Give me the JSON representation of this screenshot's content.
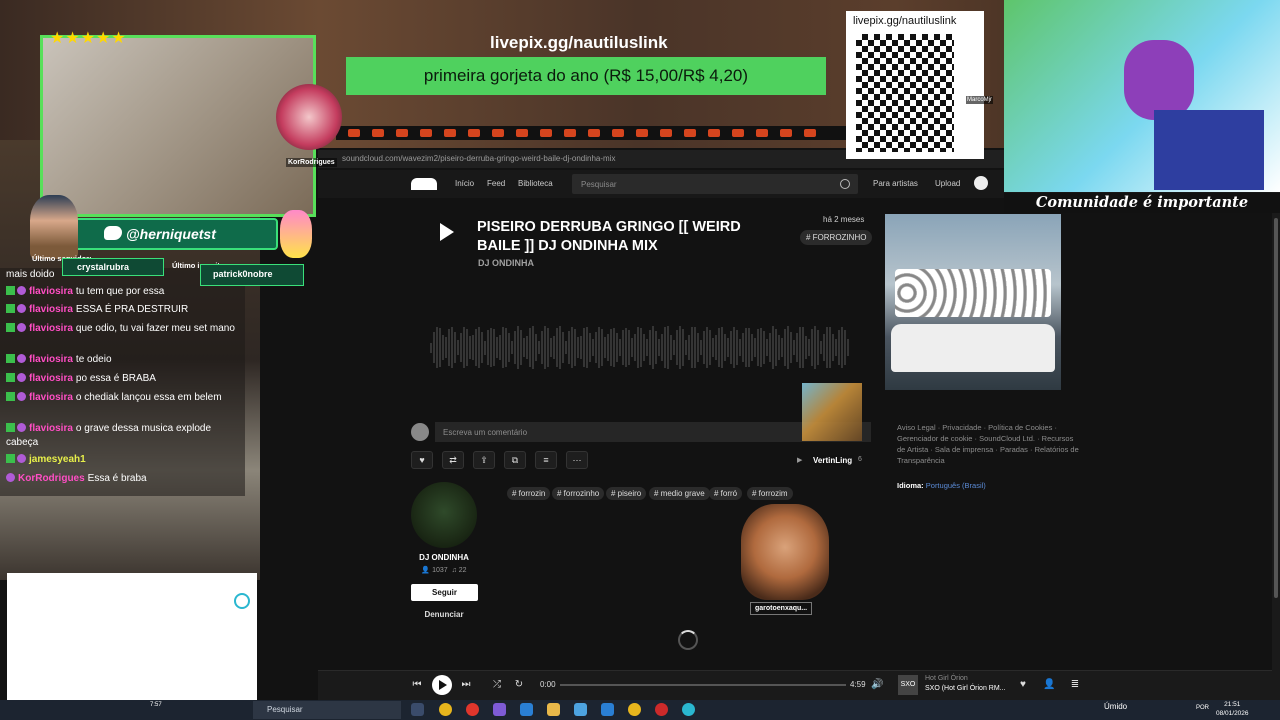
{
  "stream_overlay": {
    "donation_url": "livepix.gg/nautiluslink",
    "donation_message": "primeira gorjeta do ano (R$ 15,00/R$ 4,20)",
    "rating_stars": "★★★★★",
    "twitter_handle": "@herniquetst",
    "last_follower_label": "Último seguidor:",
    "last_follower": "crystalrubra",
    "last_subscriber_label": "Último inscrito:",
    "last_subscriber": "patrick0nobre",
    "qr_url": "livepix.gg/nautiluslink",
    "community_text": "Comunidade é importante",
    "user_tag_1": "KorRodrigues",
    "user_tag_2": "MarcoMjr",
    "sprite_user_1": "VertinLing",
    "sprite_user_2": "garotoenxaqu...",
    "webcam_time": "7:57"
  },
  "chat": {
    "messages": [
      {
        "user": "mais ",
        "text": "doido"
      },
      {
        "user": "flaviosira",
        "text": "tu tem que por essa"
      },
      {
        "user": "flaviosira",
        "text": "ESSA É PRA DESTRUIR"
      },
      {
        "user": "flaviosira",
        "text": "que odio, tu vai fazer meu set mano"
      },
      {
        "user": "flaviosira",
        "text": "te odeio"
      },
      {
        "user": "flaviosira",
        "text": "po essa é BRABA"
      },
      {
        "user": "flaviosira",
        "text": "o chediak lançou essa em belem"
      },
      {
        "user": "flaviosira",
        "text": "o grave dessa musica explode cabeça"
      },
      {
        "user": "jamesyeah1",
        "text": ""
      },
      {
        "user": "KorRodrigues",
        "text": "Essa é braba"
      }
    ]
  },
  "browser": {
    "url": "soundcloud.com/wavezim2/piseiro-derruba-gringo-weird-baile-dj-ondinha-mix"
  },
  "soundcloud": {
    "nav": {
      "home": "Início",
      "feed": "Feed",
      "library": "Biblioteca",
      "search_placeholder": "Pesquisar",
      "for_artists": "Para artistas",
      "upload": "Upload"
    },
    "track": {
      "title": "PISEIRO DERRUBA GRINGO [[ WEIRD BAILE ]] DJ ONDINHA MIX",
      "artist": "DJ ONDINHA",
      "posted": "há 2 meses",
      "genre": "# FORROZINHO",
      "comment_placeholder": "Escreva um comentário",
      "repost_count": "6",
      "tags": [
        "# forrozin",
        "# forrozinho",
        "# piseiro",
        "# medio grave",
        "# forró",
        "# forrozim"
      ]
    },
    "artist_card": {
      "name": "DJ ONDINHA",
      "followers": "1037",
      "tracks": "22",
      "follow_label": "Seguir",
      "report_label": "Denunciar"
    },
    "footer": {
      "links": "Aviso Legal · Privacidade · Política de Cookies · Gerenciador de cookie · SoundCloud Ltd. · Recursos de Artista · Sala de imprensa · Paradas · Relatórios de Transparência",
      "language_label": "Idioma:",
      "language_value": "Português (Brasil)"
    },
    "player": {
      "current_time": "0:00",
      "duration": "4:59",
      "artist": "Hot Girl Órion",
      "title": "SXO (Hot Girl Órion RM...",
      "progress": 0
    }
  },
  "taskbar": {
    "search_placeholder": "Pesquisar",
    "weather": "Úmido",
    "language": "POR",
    "time": "21:51",
    "date": "08/01/2026"
  }
}
